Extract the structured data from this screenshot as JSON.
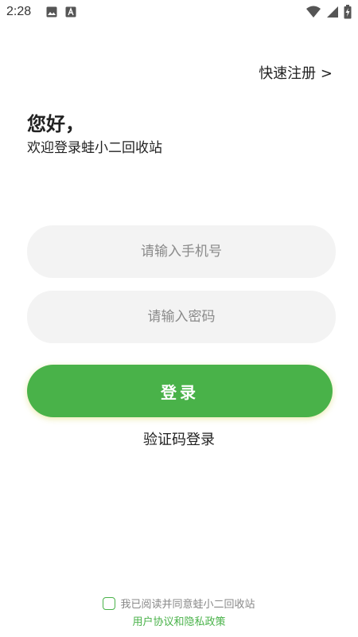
{
  "status_bar": {
    "time": "2:28",
    "icons": [
      "image-icon",
      "text-a-icon",
      "wifi-icon",
      "signal-icon",
      "battery-charging-icon"
    ]
  },
  "header": {
    "register_link": "快速注册 >"
  },
  "greeting": {
    "title": "您好，",
    "subtitle": "欢迎登录蛙小二回收站"
  },
  "form": {
    "phone_placeholder": "请输入手机号",
    "password_placeholder": "请输入密码",
    "login_label": "登录",
    "code_login_label": "验证码登录"
  },
  "agreement": {
    "text": "我已阅读并同意蛙小二回收站",
    "policy_link": "用户协议和隐私政策",
    "checked": false
  },
  "colors": {
    "accent": "#49b249",
    "input_bg": "#f3f3f3"
  }
}
